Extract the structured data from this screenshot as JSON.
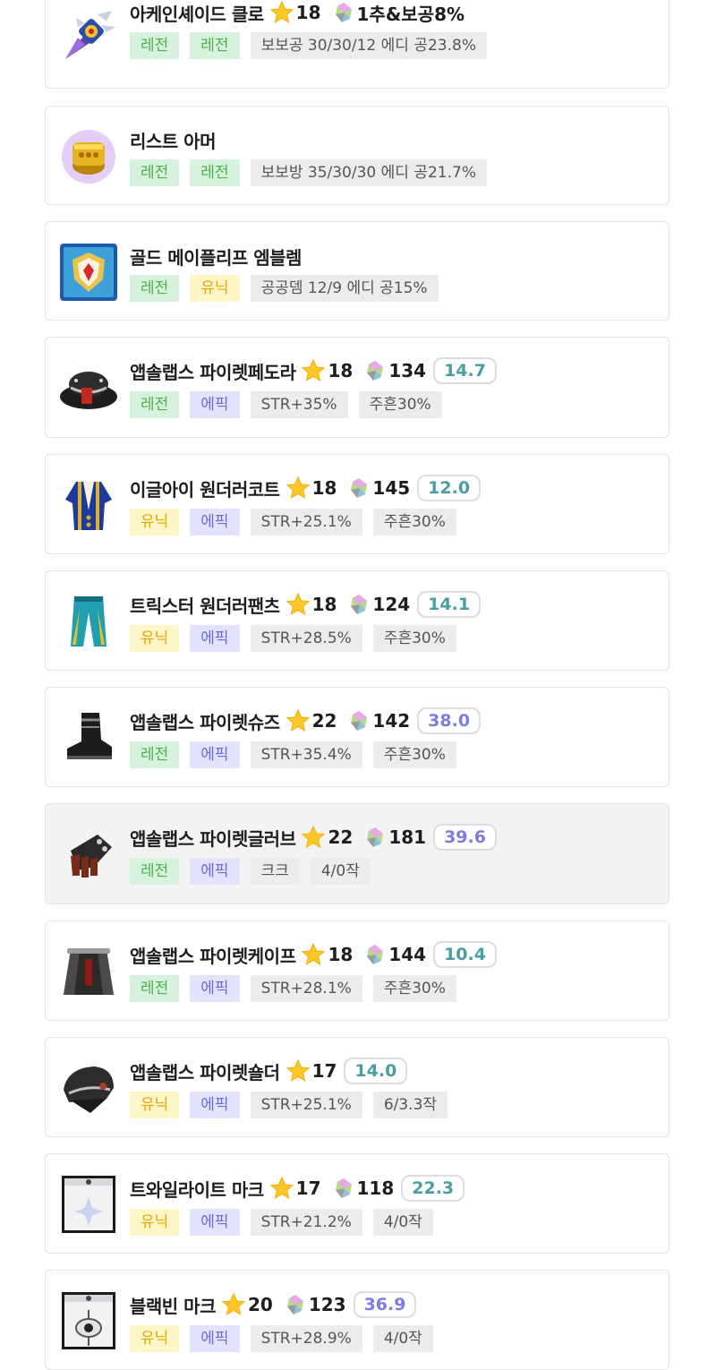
{
  "colors": {
    "legendary_text": "#4caf50",
    "legendary_bg": "#d6f2dd",
    "unique_text": "#e3a600",
    "unique_bg": "#fff6c8",
    "epic_text": "#6b6bd8",
    "epic_bg": "#e3e3fb",
    "option_bg": "#ececec",
    "score_teal": "#4a9ea1",
    "score_purple": "#7d7de0",
    "star": "#ffc62a"
  },
  "items": [
    {
      "name": "아케인셰이드 클로",
      "icon": "arcane-claw-icon",
      "star": "18",
      "cube_text": "1추&보공8%",
      "score": null,
      "tags": [
        {
          "label": "레전",
          "type": "leg"
        },
        {
          "label": "레전",
          "type": "leg"
        },
        {
          "label": "보보공 30/30/12 에디 공23.8%",
          "type": "opt"
        }
      ]
    },
    {
      "name": "리스트 아머",
      "icon": "wrist-armor-icon",
      "star": null,
      "cube_text": null,
      "score": null,
      "tags": [
        {
          "label": "레전",
          "type": "leg"
        },
        {
          "label": "레전",
          "type": "leg"
        },
        {
          "label": "보보방 35/30/30 에디 공21.7%",
          "type": "opt"
        }
      ]
    },
    {
      "name": "골드 메이플리프 엠블렘",
      "icon": "emblem-icon",
      "star": null,
      "cube_text": null,
      "score": null,
      "tags": [
        {
          "label": "레전",
          "type": "leg"
        },
        {
          "label": "유닉",
          "type": "uni"
        },
        {
          "label": "공공뎀 12/9 에디 공15%",
          "type": "opt"
        }
      ]
    },
    {
      "name": "앱솔랩스 파이렛페도라",
      "icon": "fedora-hat-icon",
      "star": "18",
      "cube_text": "134",
      "score": "14.7",
      "score_color": "teal",
      "tags": [
        {
          "label": "레전",
          "type": "leg"
        },
        {
          "label": "에픽",
          "type": "epi"
        },
        {
          "label": "STR+35%",
          "type": "opt"
        },
        {
          "label": "주흔30%",
          "type": "opt"
        }
      ]
    },
    {
      "name": "이글아이 원더러코트",
      "icon": "coat-icon",
      "star": "18",
      "cube_text": "145",
      "score": "12.0",
      "score_color": "teal",
      "tags": [
        {
          "label": "유닉",
          "type": "uni"
        },
        {
          "label": "에픽",
          "type": "epi"
        },
        {
          "label": "STR+25.1%",
          "type": "opt"
        },
        {
          "label": "주흔30%",
          "type": "opt"
        }
      ]
    },
    {
      "name": "트릭스터 원더러팬츠",
      "icon": "pants-icon",
      "star": "18",
      "cube_text": "124",
      "score": "14.1",
      "score_color": "teal",
      "tags": [
        {
          "label": "유닉",
          "type": "uni"
        },
        {
          "label": "에픽",
          "type": "epi"
        },
        {
          "label": "STR+28.5%",
          "type": "opt"
        },
        {
          "label": "주흔30%",
          "type": "opt"
        }
      ]
    },
    {
      "name": "앱솔랩스 파이렛슈즈",
      "icon": "shoes-icon",
      "star": "22",
      "cube_text": "142",
      "score": "38.0",
      "score_color": "purple",
      "tags": [
        {
          "label": "레전",
          "type": "leg"
        },
        {
          "label": "에픽",
          "type": "epi"
        },
        {
          "label": "STR+35.4%",
          "type": "opt"
        },
        {
          "label": "주흔30%",
          "type": "opt"
        }
      ]
    },
    {
      "name": "앱솔랩스 파이렛글러브",
      "icon": "glove-icon",
      "star": "22",
      "cube_text": "181",
      "score": "39.6",
      "score_color": "purple",
      "highlight": true,
      "tags": [
        {
          "label": "레전",
          "type": "leg"
        },
        {
          "label": "에픽",
          "type": "epi"
        },
        {
          "label": "크크",
          "type": "opt"
        },
        {
          "label": "4/0작",
          "type": "opt"
        }
      ]
    },
    {
      "name": "앱솔랩스 파이렛케이프",
      "icon": "cape-icon",
      "star": "18",
      "cube_text": "144",
      "score": "10.4",
      "score_color": "teal",
      "tags": [
        {
          "label": "레전",
          "type": "leg"
        },
        {
          "label": "에픽",
          "type": "epi"
        },
        {
          "label": "STR+28.1%",
          "type": "opt"
        },
        {
          "label": "주흔30%",
          "type": "opt"
        }
      ]
    },
    {
      "name": "앱솔랩스 파이렛숄더",
      "icon": "shoulder-icon",
      "star": "17",
      "cube_text": null,
      "score": "14.0",
      "score_color": "teal",
      "tags": [
        {
          "label": "유닉",
          "type": "uni"
        },
        {
          "label": "에픽",
          "type": "epi"
        },
        {
          "label": "STR+25.1%",
          "type": "opt"
        },
        {
          "label": "6/3.3작",
          "type": "opt"
        }
      ]
    },
    {
      "name": "트와일라이트 마크",
      "icon": "twilight-mark-icon",
      "star": "17",
      "cube_text": "118",
      "score": "22.3",
      "score_color": "teal",
      "tags": [
        {
          "label": "유닉",
          "type": "uni"
        },
        {
          "label": "에픽",
          "type": "epi"
        },
        {
          "label": "STR+21.2%",
          "type": "opt"
        },
        {
          "label": "4/0작",
          "type": "opt"
        }
      ]
    },
    {
      "name": "블랙빈 마크",
      "icon": "blackbean-mark-icon",
      "star": "20",
      "cube_text": "123",
      "score": "36.9",
      "score_color": "purple",
      "tags": [
        {
          "label": "유닉",
          "type": "uni"
        },
        {
          "label": "에픽",
          "type": "epi"
        },
        {
          "label": "STR+28.9%",
          "type": "opt"
        },
        {
          "label": "4/0작",
          "type": "opt"
        }
      ]
    }
  ]
}
